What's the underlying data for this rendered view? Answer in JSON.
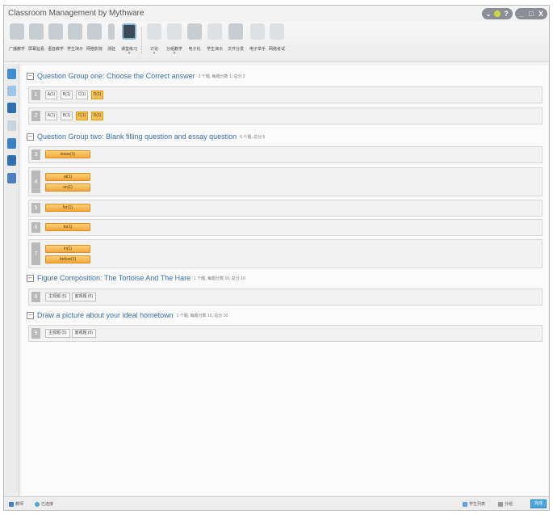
{
  "window": {
    "title": "Classroom Management by Mythware"
  },
  "window_controls": {
    "help_label": "?",
    "minimize_label": "_",
    "restore_label": "□",
    "close_label": "X"
  },
  "toolbar": {
    "items": [
      {
        "label": "广播教学"
      },
      {
        "label": "屏幕监看"
      },
      {
        "label": "语音教学"
      },
      {
        "label": "学生演示"
      },
      {
        "label": "网络影院"
      },
      {
        "label": "测验"
      },
      {
        "label": "课堂练习"
      },
      {
        "label": "讨论"
      },
      {
        "label": "分组教学"
      },
      {
        "label": "电子化"
      },
      {
        "label": "学生演示"
      },
      {
        "label": "文件分发"
      },
      {
        "label": "电子举手"
      },
      {
        "label": "网络考试"
      }
    ]
  },
  "groups": [
    {
      "title": "Question Group one: Choose the Correct answer",
      "meta": "2 个题, 每题分数 1, 总分 2",
      "questions": [
        {
          "number": "1",
          "options": [
            "A(1)",
            "B(1)",
            "C(1)",
            "D(1)"
          ]
        },
        {
          "number": "2",
          "options": [
            "A(1)",
            "B(1)",
            "C(1)",
            "D(1)"
          ]
        }
      ]
    },
    {
      "title": "Question Group two: Blank filling question and essay question",
      "meta": "5 个题, 总分 5",
      "questions": [
        {
          "number": "3",
          "answers": [
            "leave(1)"
          ]
        },
        {
          "number": "4",
          "answers": [
            "at(1)",
            "on(1)"
          ]
        },
        {
          "number": "5",
          "answers": [
            "for(1)"
          ]
        },
        {
          "number": "6",
          "answers": [
            "to(1)"
          ]
        },
        {
          "number": "7",
          "answers": [
            "in(1)",
            "before(1)"
          ]
        }
      ]
    },
    {
      "title": "Figure Composition: The Tortoise And The Hare",
      "meta": "1 个题, 每题分数 10, 总分 10",
      "questions": [
        {
          "number": "8",
          "scores": [
            "主观题 (5)",
            "客观题 (5)"
          ]
        }
      ]
    },
    {
      "title": "Draw a picture about your ideal hometown",
      "meta": "1 个题, 每题分数 10, 总分 10",
      "questions": [
        {
          "number": "9",
          "scores": [
            "主观题 (5)",
            "客观题 (5)"
          ]
        }
      ]
    }
  ],
  "statusbar": {
    "left_items": [
      "教师",
      "已连接"
    ],
    "right_items": [
      "学生列表",
      "分组"
    ],
    "button_label": "完成"
  },
  "colors": {
    "selected_option": "#f7c04a",
    "answer_fill": "#f4a63b",
    "title_blue": "#3a6fa8"
  }
}
